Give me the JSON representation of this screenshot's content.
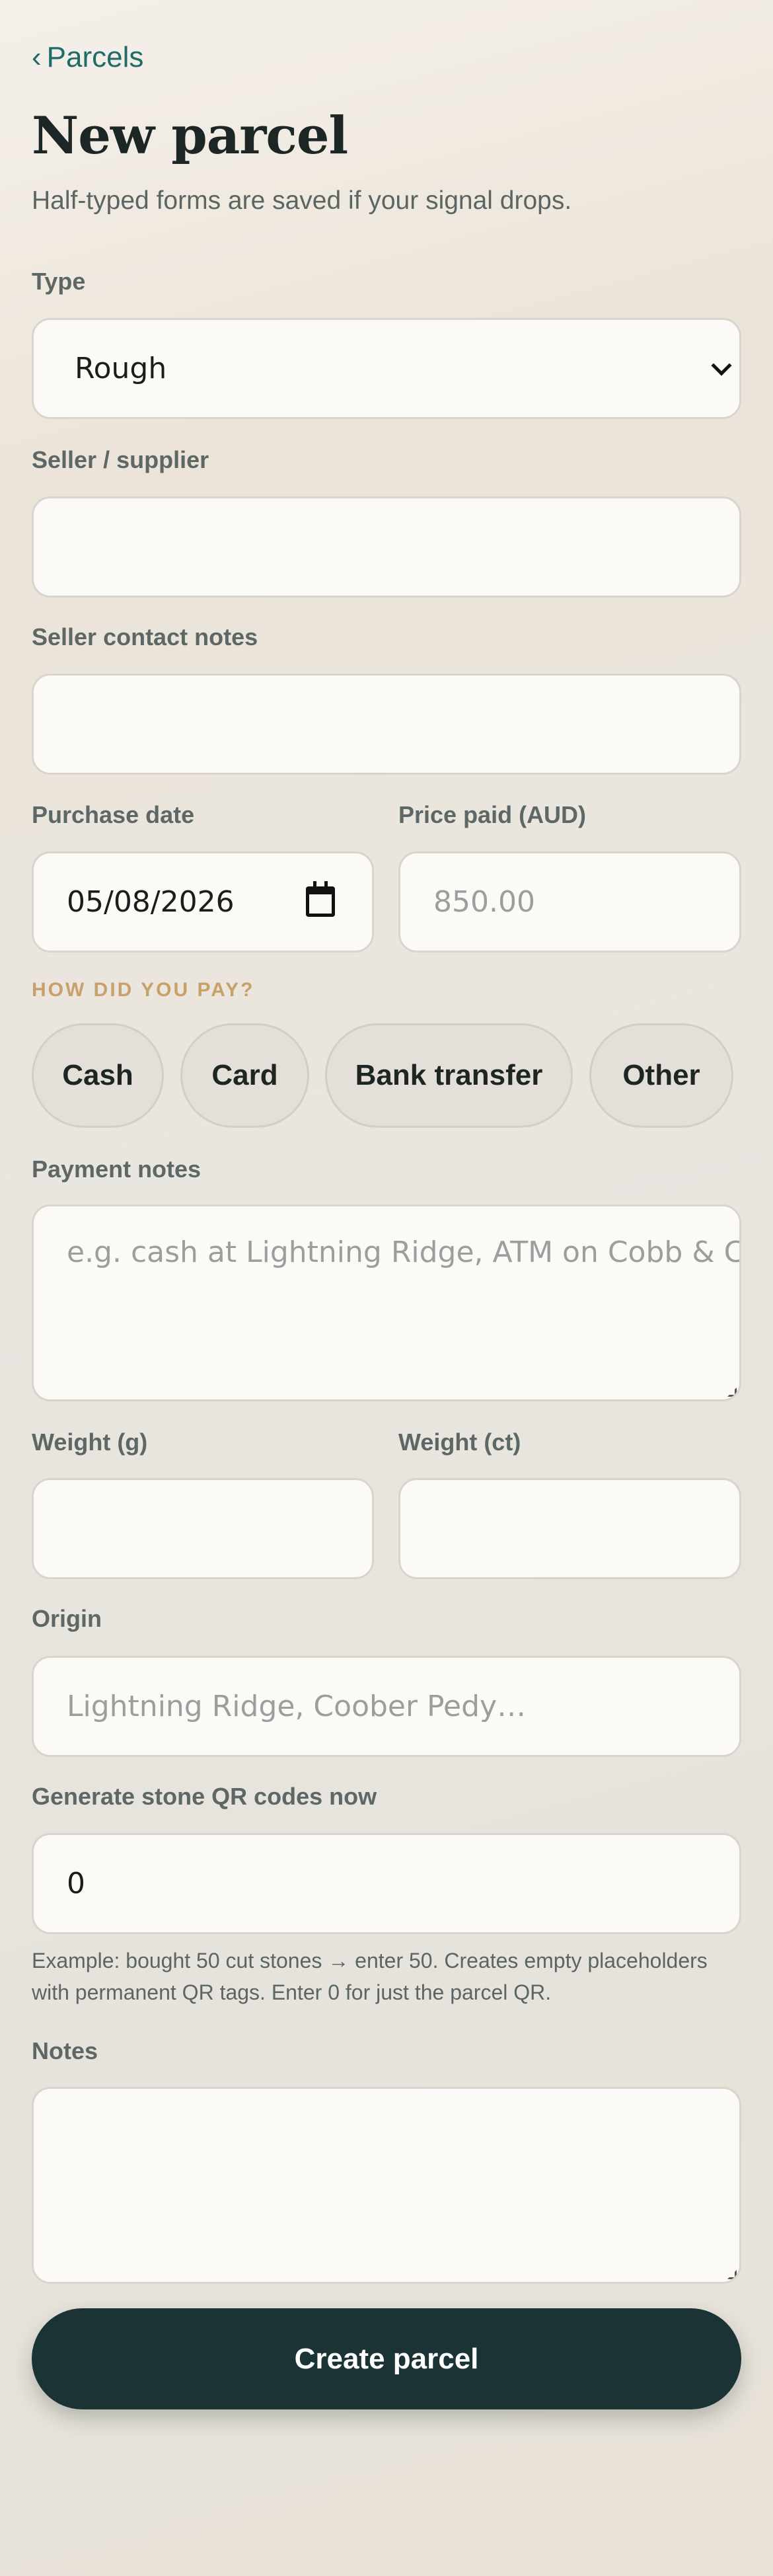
{
  "nav": {
    "back_label": "Parcels"
  },
  "header": {
    "title": "New parcel",
    "subtitle": "Half-typed forms are saved if your signal drops."
  },
  "form": {
    "type": {
      "label": "Type",
      "value": "Rough"
    },
    "seller": {
      "label": "Seller / supplier",
      "value": ""
    },
    "seller_contact": {
      "label": "Seller contact notes",
      "value": ""
    },
    "purchase_date": {
      "label": "Purchase date",
      "value": "05/08/2026"
    },
    "price": {
      "label": "Price paid (AUD)",
      "placeholder": "850.00"
    },
    "payment_method": {
      "heading": "HOW DID YOU PAY?",
      "options": [
        "Cash",
        "Card",
        "Bank transfer",
        "Other"
      ]
    },
    "payment_notes": {
      "label": "Payment notes",
      "placeholder": "e.g. cash at Lightning Ridge, ATM on Cobb & Co"
    },
    "weight_g": {
      "label": "Weight (g)",
      "value": ""
    },
    "weight_ct": {
      "label": "Weight (ct)",
      "value": ""
    },
    "origin": {
      "label": "Origin",
      "placeholder": "Lightning Ridge, Coober Pedy…"
    },
    "qr_codes": {
      "label": "Generate stone QR codes now",
      "value": "0",
      "helper": "Example: bought 50 cut stones → enter 50. Creates empty placeholders with permanent QR tags. Enter 0 for just the parcel QR."
    },
    "notes": {
      "label": "Notes",
      "value": ""
    },
    "submit_label": "Create parcel"
  },
  "colors": {
    "accent": "#1f6b66",
    "kicker": "#c8a06a",
    "submit_bg": "#1b3334",
    "field_bg": "#fcfaf6",
    "chip_bg": "#e4e0d9"
  },
  "icons": [
    "chevron-left-icon",
    "chevron-down-icon",
    "calendar-icon",
    "resize-grip-icon"
  ]
}
